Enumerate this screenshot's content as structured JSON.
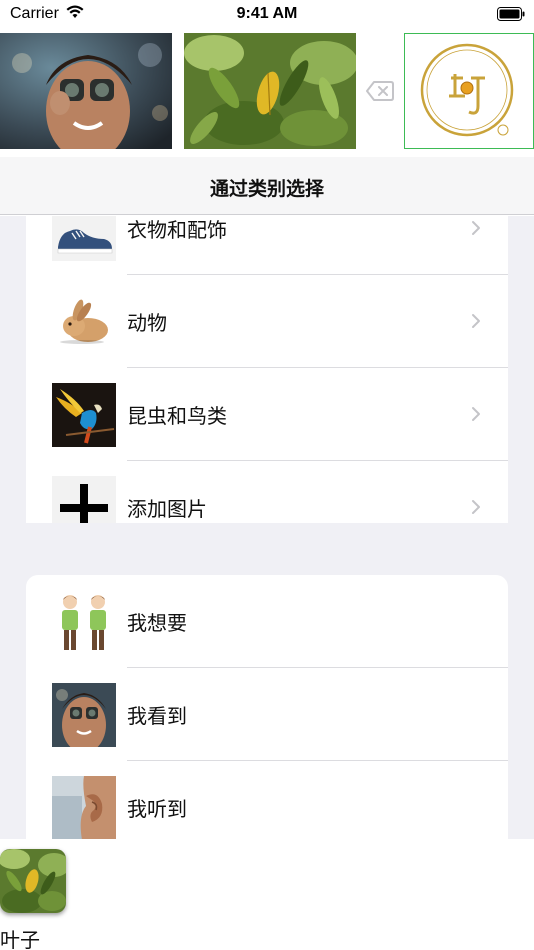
{
  "status_bar": {
    "carrier": "Carrier",
    "time": "9:41 AM"
  },
  "strip": {
    "images": [
      {
        "icon": "person-binoculars-photo"
      },
      {
        "icon": "leaves-photo"
      }
    ],
    "delete_icon": "backspace-icon",
    "logo_icon": "gold-circle-logo"
  },
  "nav": {
    "title": "通过类别选择"
  },
  "categories": [
    {
      "label": "衣物和配饰",
      "icon": "shoe-photo"
    },
    {
      "label": "动物",
      "icon": "rabbit-photo"
    },
    {
      "label": "昆虫和鸟类",
      "icon": "parrot-photo"
    },
    {
      "label": "添加图片",
      "icon": "plus-icon"
    }
  ],
  "phrases": [
    {
      "label": "我想要",
      "icon": "two-women-photo"
    },
    {
      "label": "我看到",
      "icon": "person-binoculars-photo"
    },
    {
      "label": "我听到",
      "icon": "ear-photo"
    }
  ],
  "selection": {
    "label": "叶子",
    "icon": "leaves-photo"
  },
  "colors": {
    "nav_background": "#f6f6f7",
    "grouped_background": "#f0f0f5",
    "logo_border": "#3dbb55",
    "logo_gold": "#c9a33a"
  }
}
